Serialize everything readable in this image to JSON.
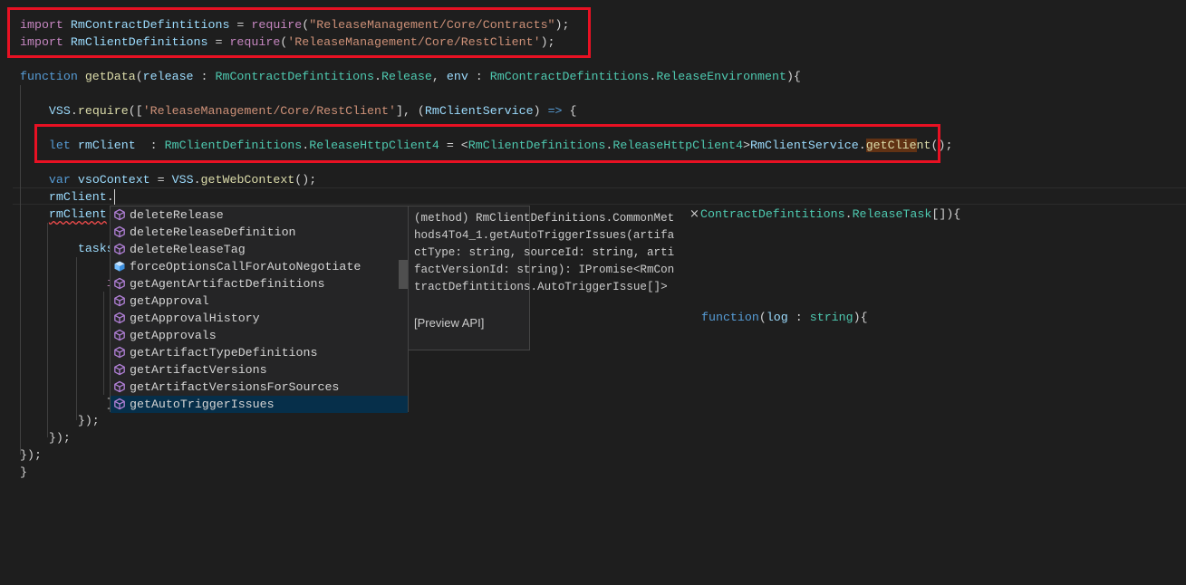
{
  "code": {
    "lines": [
      [
        [
          "i",
          "import"
        ],
        [
          "p",
          " "
        ],
        [
          "v",
          "RmContractDefintitions"
        ],
        [
          "p",
          " = "
        ],
        [
          "i",
          "require"
        ],
        [
          "p",
          "("
        ],
        [
          "s",
          "\"ReleaseManagement/Core/Contracts\""
        ],
        [
          "p",
          ");"
        ]
      ],
      [
        [
          "i",
          "import"
        ],
        [
          "p",
          " "
        ],
        [
          "v",
          "RmClientDefinitions"
        ],
        [
          "p",
          " = "
        ],
        [
          "i",
          "require"
        ],
        [
          "p",
          "("
        ],
        [
          "s",
          "'ReleaseManagement/Core/RestClient'"
        ],
        [
          "p",
          ");"
        ]
      ],
      [],
      [
        [
          "k",
          "function"
        ],
        [
          "p",
          " "
        ],
        [
          "f",
          "getData"
        ],
        [
          "p",
          "("
        ],
        [
          "v",
          "release"
        ],
        [
          "p",
          " : "
        ],
        [
          "t",
          "RmContractDefintitions"
        ],
        [
          "p",
          "."
        ],
        [
          "t",
          "Release"
        ],
        [
          "p",
          ", "
        ],
        [
          "v",
          "env"
        ],
        [
          "p",
          " : "
        ],
        [
          "t",
          "RmContractDefintitions"
        ],
        [
          "p",
          "."
        ],
        [
          "t",
          "ReleaseEnvironment"
        ],
        [
          "p",
          "){"
        ]
      ],
      [],
      [
        [
          "p",
          "    "
        ],
        [
          "v",
          "VSS"
        ],
        [
          "p",
          "."
        ],
        [
          "f",
          "require"
        ],
        [
          "p",
          "(["
        ],
        [
          "s",
          "'ReleaseManagement/Core/RestClient'"
        ],
        [
          "p",
          "], ("
        ],
        [
          "v",
          "RmClientService"
        ],
        [
          "p",
          ") "
        ],
        [
          "k",
          "=>"
        ],
        [
          "p",
          " {"
        ]
      ],
      [],
      [
        [
          "p",
          "    "
        ],
        [
          "k",
          "let"
        ],
        [
          "p",
          " "
        ],
        [
          "v",
          "rmClient"
        ],
        [
          "p",
          "  : "
        ],
        [
          "t",
          "RmClientDefinitions"
        ],
        [
          "p",
          "."
        ],
        [
          "t",
          "ReleaseHttpClient4"
        ],
        [
          "p",
          " = <"
        ],
        [
          "t",
          "RmClientDefinitions"
        ],
        [
          "p",
          "."
        ],
        [
          "t",
          "ReleaseHttpClient4"
        ],
        [
          "p",
          ">"
        ],
        [
          "v",
          "RmClientService"
        ],
        [
          "p",
          "."
        ],
        [
          "f hl",
          "getClie"
        ],
        [
          "f",
          "nt"
        ],
        [
          "p",
          "();"
        ]
      ],
      [],
      [
        [
          "p",
          "    "
        ],
        [
          "k",
          "var"
        ],
        [
          "p",
          " "
        ],
        [
          "v",
          "vsoContext"
        ],
        [
          "p",
          " = "
        ],
        [
          "v",
          "VSS"
        ],
        [
          "p",
          "."
        ],
        [
          "f",
          "getWebContext"
        ],
        [
          "p",
          "();"
        ]
      ],
      [
        [
          "p",
          "    "
        ],
        [
          "v",
          "rmClient"
        ],
        [
          "p",
          "."
        ],
        [
          "cursor",
          ""
        ]
      ],
      [
        [
          "p",
          "    "
        ],
        [
          "v sq",
          "rmClient"
        ],
        [
          "p",
          "."
        ]
      ],
      [],
      [
        [
          "p",
          "        "
        ],
        [
          "v",
          "tasks"
        ]
      ],
      [],
      [
        [
          "p",
          "            "
        ],
        [
          "i",
          "i"
        ]
      ],
      [],
      [],
      [],
      [],
      [],
      [],
      [
        [
          "p",
          "            }"
        ]
      ],
      [
        [
          "p",
          "        });"
        ]
      ],
      [
        [
          "p",
          "    });"
        ]
      ],
      [
        [
          "p",
          "});"
        ]
      ],
      [
        [
          "p",
          "}"
        ]
      ]
    ],
    "fragments": {
      "release_task": [
        [
          "t",
          "ContractDefintitions"
        ],
        [
          "p",
          "."
        ],
        [
          "t",
          "ReleaseTask"
        ],
        [
          "p",
          "[]){"
        ]
      ],
      "log_function": [
        [
          "k",
          "function"
        ],
        [
          "p",
          "("
        ],
        [
          "v",
          "log"
        ],
        [
          "p",
          " : "
        ],
        [
          "t",
          "string"
        ],
        [
          "p",
          "){"
        ]
      ]
    }
  },
  "suggestions": {
    "items": [
      {
        "label": "deleteRelease",
        "icon": "method-icon"
      },
      {
        "label": "deleteReleaseDefinition",
        "icon": "method-icon"
      },
      {
        "label": "deleteReleaseTag",
        "icon": "method-icon"
      },
      {
        "label": "forceOptionsCallForAutoNegotiate",
        "icon": "field-icon"
      },
      {
        "label": "getAgentArtifactDefinitions",
        "icon": "method-icon"
      },
      {
        "label": "getApproval",
        "icon": "method-icon"
      },
      {
        "label": "getApprovalHistory",
        "icon": "method-icon"
      },
      {
        "label": "getApprovals",
        "icon": "method-icon"
      },
      {
        "label": "getArtifactTypeDefinitions",
        "icon": "method-icon"
      },
      {
        "label": "getArtifactVersions",
        "icon": "method-icon"
      },
      {
        "label": "getArtifactVersionsForSources",
        "icon": "method-icon"
      },
      {
        "label": "getAutoTriggerIssues",
        "icon": "method-icon",
        "selected": true
      }
    ],
    "details": {
      "signature_lines": [
        "(method) RmClientDefinitions.CommonMet",
        "hods4To4_1.getAutoTriggerIssues(artifa",
        "ctType: string, sourceId: string, arti",
        "factVersionId: string): IPromise<RmCon",
        "tractDefintitions.AutoTriggerIssue[]>"
      ],
      "note": "[Preview API]",
      "close": "×"
    }
  },
  "colors": {
    "highlight_box": "#e81123",
    "selection": "#062f4a",
    "method_icon": "#b180d7",
    "field_icon": "#75beff"
  }
}
